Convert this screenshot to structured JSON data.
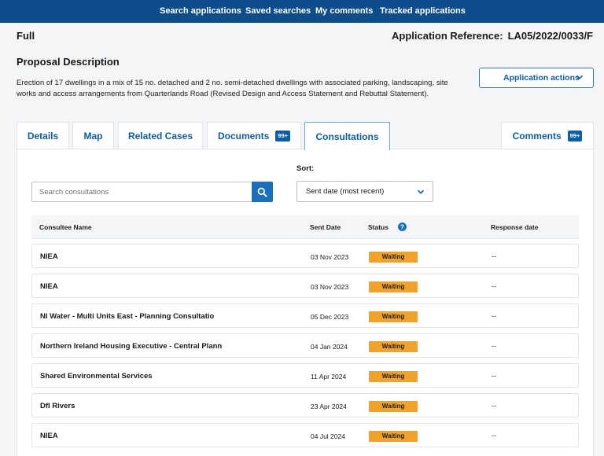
{
  "nav": {
    "items": [
      "Search applications",
      "Saved searches",
      "My comments",
      "Tracked applications"
    ]
  },
  "application": {
    "type": "Full",
    "reference_label": "Application Reference:",
    "reference": "LA05/2022/0033/F"
  },
  "proposal": {
    "heading": "Proposal Description",
    "text": "Erection of 17 dwellings in a mix of 15 no. detached and 2 no. semi-detached dwellings with associated parking, landscaping, site works and access arrangements from Quarterlands Road (Revised Design and Access Statement and Rebuttal Statement)."
  },
  "actions": {
    "label": "Application actions",
    "icon": "chevron-down-icon"
  },
  "tabs": [
    {
      "label": "Details",
      "badge": ""
    },
    {
      "label": "Map",
      "badge": ""
    },
    {
      "label": "Related Cases",
      "badge": ""
    },
    {
      "label": "Documents",
      "badge": "99+"
    },
    {
      "label": "Consultations",
      "badge": "",
      "active": true
    },
    {
      "label": "Comments",
      "badge": "99+"
    }
  ],
  "consultations": {
    "search_placeholder": "Search consultations",
    "search_icon": "search-icon",
    "sort_label": "Sort:",
    "sort_value": "Sent date (most recent)",
    "columns": {
      "name": "Consultee Name",
      "sent": "Sent Date",
      "status": "Status",
      "response": "Response date"
    },
    "status_color": "#f2a229",
    "rows": [
      {
        "name": "NIEA",
        "sent": "03 Nov 2023",
        "status": "Waiting",
        "response": "--"
      },
      {
        "name": "NIEA",
        "sent": "03 Nov 2023",
        "status": "Waiting",
        "response": "--"
      },
      {
        "name": "NI Water - Multi Units East - Planning Consultatio",
        "sent": "05 Dec 2023",
        "status": "Waiting",
        "response": "--"
      },
      {
        "name": "Northern Ireland Housing Executive - Central Plann",
        "sent": "04 Jan 2024",
        "status": "Waiting",
        "response": "--"
      },
      {
        "name": "Shared Environmental Services",
        "sent": "11 Apr 2024",
        "status": "Waiting",
        "response": "--"
      },
      {
        "name": "DfI Rivers",
        "sent": "23 Apr 2024",
        "status": "Waiting",
        "response": "--"
      },
      {
        "name": "NIEA",
        "sent": "04 Jul 2024",
        "status": "Waiting",
        "response": "--"
      }
    ]
  }
}
